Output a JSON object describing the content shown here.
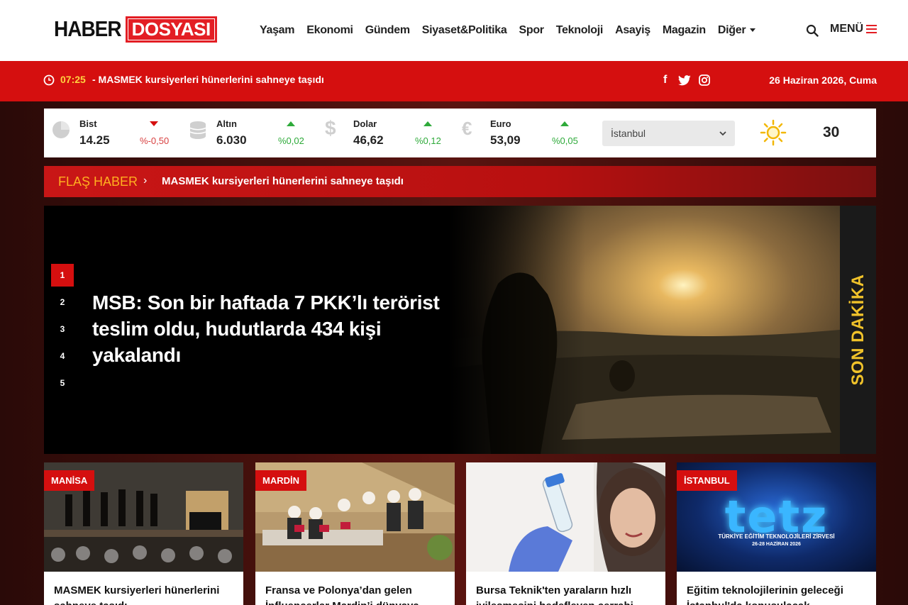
{
  "header": {
    "logo_left": "HABER",
    "logo_right": "DOSYASI",
    "nav": [
      "Yaşam",
      "Ekonomi",
      "Gündem",
      "Siyaset&Politika",
      "Spor",
      "Teknoloji",
      "Asayiş",
      "Magazin",
      "Diğer"
    ],
    "menu_label": "MENÜ"
  },
  "ticker": {
    "time": "07:25",
    "text": "- MASMEK kursiyerleri hünerlerini sahneye taşıdı",
    "date": "26 Haziran 2026, Cuma"
  },
  "social": {
    "facebook": "f",
    "twitter": "twitter-icon",
    "instagram": "instagram-icon"
  },
  "markets": [
    {
      "name": "Bist",
      "value": "14.25",
      "change": "%-0,50",
      "direction": "down"
    },
    {
      "name": "Altın",
      "value": "6.030",
      "change": "%0,02",
      "direction": "up"
    },
    {
      "name": "Dolar",
      "value": "46,62",
      "change": "%0,12",
      "direction": "up"
    },
    {
      "name": "Euro",
      "value": "53,09",
      "change": "%0,05",
      "direction": "up"
    }
  ],
  "weather": {
    "city": "İstanbul",
    "temp": "30"
  },
  "flash": {
    "label": "FLAŞ HABER",
    "arrow": "›",
    "text": "MASMEK kursiyerleri hünerlerini sahneye taşıdı"
  },
  "hero": {
    "pages": [
      "1",
      "2",
      "3",
      "4",
      "5"
    ],
    "active_page": "1",
    "title": "MSB: Son bir haftada 7 PKK’lı terörist teslim oldu, hudutlarda 434 kişi yakalandı",
    "side_label": "SON DAKİKA"
  },
  "cards": [
    {
      "tag": "MANİSA",
      "title": "MASMEK kursiyerleri hünerlerini sahneye taşıdı"
    },
    {
      "tag": "MARDİN",
      "title": "Fransa ve Polonya’dan gelen İnfluencerlar Mardin’i dünyaya tanıttı"
    },
    {
      "tag": "",
      "title": "Bursa Teknik'ten yaraların hızlı iyileşmesini hedefleyen cerrahi iplik"
    },
    {
      "tag": "İSTANBUL",
      "title": "Eğitim teknolojilerinin geleceği İstanbul'da konuşulacak"
    }
  ],
  "tetz": {
    "big": "tetz",
    "line1": "TÜRKİYE EĞİTİM TEKNOLOJİLERİ ZİRVESİ",
    "line2": "26-28 HAZİRAN 2026"
  },
  "colors": {
    "brand_red": "#d50f0f",
    "accent_yellow": "#f0c22a",
    "up_green": "#2eaa3a"
  }
}
